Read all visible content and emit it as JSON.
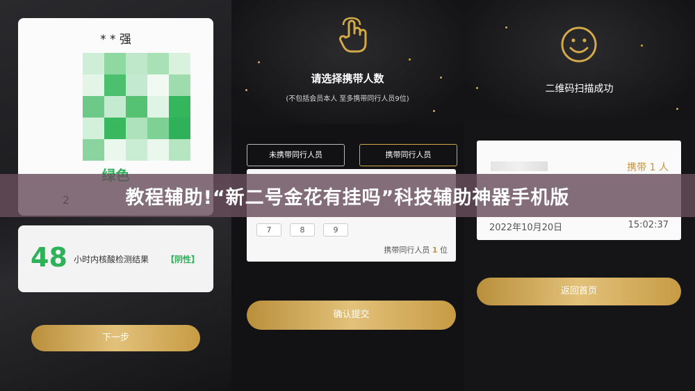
{
  "panel1": {
    "name": "* * 强",
    "status_color_label": "绿色",
    "result_number": "48",
    "result_text": "小时内核酸检测结果",
    "result_badge": "【阴性】",
    "next_button": "下一步",
    "partial_date": "2"
  },
  "panel2": {
    "heading": "请选择携带人数",
    "subheading": "(不包括会员本人 至多携带同行人员9位)",
    "option_none": "未携带同行人员",
    "option_with": "携带同行人员",
    "keypad": [
      "7",
      "8",
      "9"
    ],
    "count_prefix": "携带同行人员",
    "count_value": "1",
    "count_suffix": "位",
    "submit_button": "确认提交",
    "icon": "hand-pointer-icon"
  },
  "panel3": {
    "heading": "二维码扫描成功",
    "carry_label": "携带 1 人",
    "date": "2022年10月20日",
    "time": "15:02:37",
    "home_button": "返回首页",
    "icon": "smiley-icon"
  },
  "banner": {
    "title": "教程辅助!“新二号金花有挂吗”科技辅助神器手机版"
  },
  "colors": {
    "gold": "#d4a94a",
    "green": "#2fb15a",
    "banner": "#684e5c"
  }
}
